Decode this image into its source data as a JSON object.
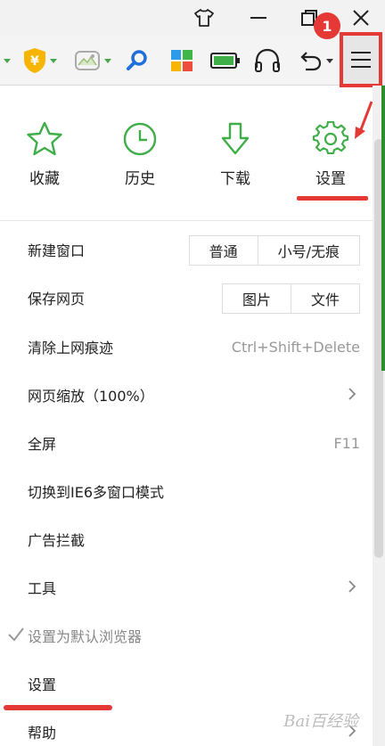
{
  "annotation": {
    "badge_number": "1"
  },
  "quick": [
    {
      "label": "收藏",
      "icon": "star-icon"
    },
    {
      "label": "历史",
      "icon": "clock-icon"
    },
    {
      "label": "下载",
      "icon": "download-arrow-icon"
    },
    {
      "label": "设置",
      "icon": "gear-icon"
    }
  ],
  "menu": {
    "new_window": {
      "label": "新建窗口",
      "options": [
        "普通",
        "小号/无痕"
      ]
    },
    "save_page": {
      "label": "保存网页",
      "options": [
        "图片",
        "文件"
      ]
    },
    "clear_traces": {
      "label": "清除上网痕迹",
      "shortcut": "Ctrl+Shift+Delete"
    },
    "zoom": {
      "label": "网页缩放（100%）"
    },
    "fullscreen": {
      "label": "全屏",
      "shortcut": "F11"
    },
    "ie6_mode": {
      "label": "切换到IE6多窗口模式"
    },
    "ad_block": {
      "label": "广告拦截"
    },
    "tools": {
      "label": "工具"
    },
    "default_browser": {
      "label": "设置为默认浏览器"
    },
    "settings": {
      "label": "设置"
    },
    "help": {
      "label": "帮助"
    }
  },
  "watermark": "Bai百经验",
  "colors": {
    "accent_green": "#3fae49",
    "annotation_red": "#e53935"
  }
}
